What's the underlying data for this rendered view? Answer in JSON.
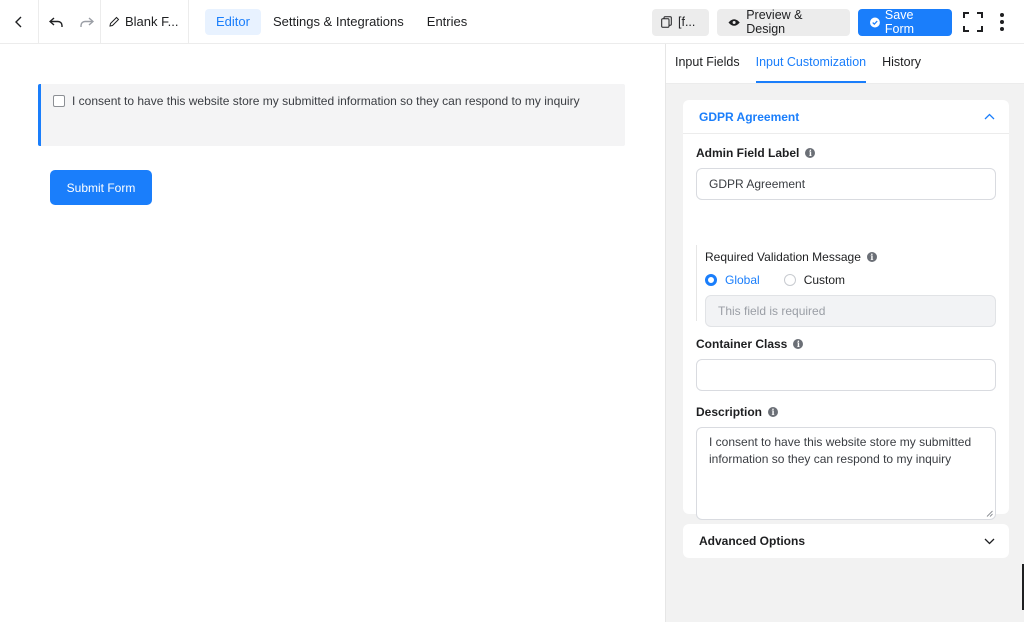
{
  "topbar": {
    "form_title": "Blank F...",
    "tabs": [
      "Editor",
      "Settings & Integrations",
      "Entries"
    ],
    "shortcode_label": "[f...",
    "preview_label": "Preview & Design",
    "save_label": "Save Form"
  },
  "canvas": {
    "consent_text": "I consent to have this website store my submitted information so they can respond to my inquiry",
    "submit_label": "Submit Form"
  },
  "panel": {
    "tabs": [
      "Input Fields",
      "Input Customization",
      "History"
    ],
    "section_title": "GDPR Agreement",
    "admin_label": "Admin Field Label",
    "admin_value": "GDPR Agreement",
    "validation_label": "Required Validation Message",
    "radio_global": "Global",
    "radio_custom": "Custom",
    "validation_placeholder": "This field is required",
    "container_label": "Container Class",
    "container_value": "",
    "description_label": "Description",
    "description_value": "I consent to have this website store my submitted information so they can respond to my inquiry",
    "advanced_label": "Advanced Options"
  },
  "colors": {
    "accent": "#1a7efb",
    "panel_bg": "#f2f2f2"
  }
}
